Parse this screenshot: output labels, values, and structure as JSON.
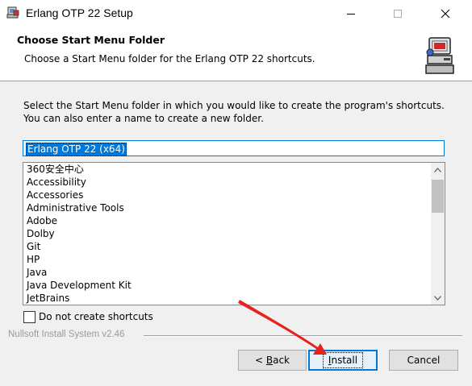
{
  "window": {
    "title": "Erlang OTP 22 Setup",
    "icon": "installer-app-icon",
    "controls": [
      "minimize",
      "maximize",
      "close"
    ]
  },
  "header": {
    "title": "Choose Start Menu Folder",
    "subtitle": "Choose a Start Menu folder for the Erlang OTP 22 shortcuts.",
    "icon": "installer-computer-icon"
  },
  "main": {
    "description": "Select the Start Menu folder in which you would like to create the program's shortcuts. You can also enter a name to create a new folder.",
    "folder_input_value": "Erlang OTP 22 (x64)",
    "folders": [
      "360安全中心",
      "Accessibility",
      "Accessories",
      "Administrative Tools",
      "Adobe",
      "Dolby",
      "Git",
      "HP",
      "Java",
      "Java Development Kit",
      "JetBrains"
    ],
    "no_shortcuts_label": "Do not create shortcuts",
    "no_shortcuts_checked": false
  },
  "footer": {
    "branding": "Nullsoft Install System v2.46",
    "back_label_prefix": "< ",
    "back_label_hotkey": "B",
    "back_label_rest": "ack",
    "install_label_hotkey": "I",
    "install_label_rest": "nstall",
    "cancel_label": "Cancel"
  },
  "colors": {
    "selection": "#0078d7",
    "annotation_arrow": "#e8231e"
  }
}
